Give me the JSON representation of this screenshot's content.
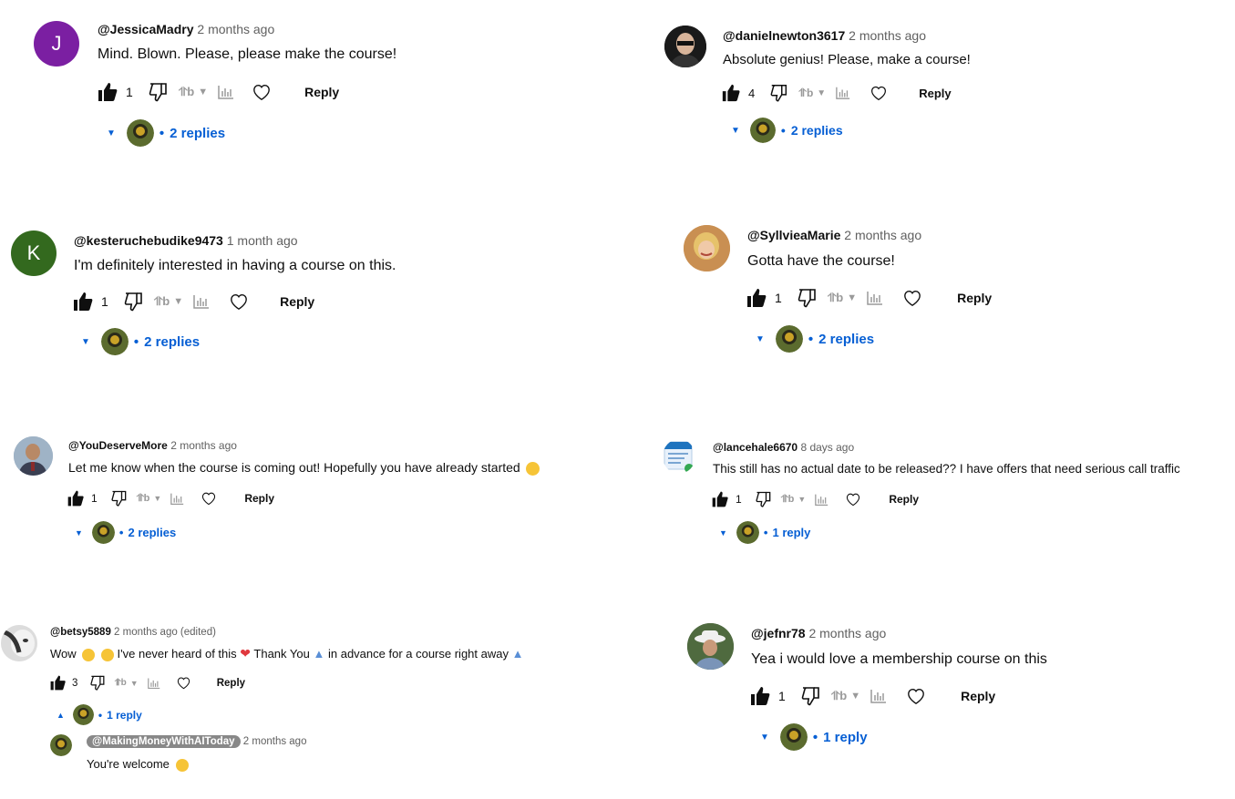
{
  "colors": {
    "link": "#065fd4",
    "muted": "#606060",
    "text": "#0f0f0f",
    "purple": "#7b1fa2",
    "green": "#33691e"
  },
  "comments": [
    {
      "author": "@JessicaMadry",
      "time": "2 months ago",
      "text": "Mind. Blown. Please, please make the course!",
      "likes": "1",
      "reply_label": "Reply",
      "replies": "2 replies",
      "avatar_letter": "J"
    },
    {
      "author": "@danielnewton3617",
      "time": "2 months ago",
      "text": "Absolute genius! Please, make a course!",
      "likes": "4",
      "reply_label": "Reply",
      "replies": "2 replies"
    },
    {
      "author": "@kesteruchebudike9473",
      "time": "1 month ago",
      "text": "I'm definitely interested in having a course on this.",
      "likes": "1",
      "reply_label": "Reply",
      "replies": "2 replies",
      "avatar_letter": "K"
    },
    {
      "author": "@SyllvieaMarie",
      "time": "2 months ago",
      "text": "Gotta have the course!",
      "likes": "1",
      "reply_label": "Reply",
      "replies": "2 replies"
    },
    {
      "author": "@YouDeserveMore",
      "time": "2 months ago",
      "text": "Let me know when the course is coming out! Hopefully you have already started",
      "likes": "1",
      "reply_label": "Reply",
      "replies": "2 replies"
    },
    {
      "author": "@lancehale6670",
      "time": "8 days ago",
      "text": "This still has no actual date to be released?? I have offers that need serious call traffic",
      "likes": "1",
      "reply_label": "Reply",
      "replies": "1 reply"
    },
    {
      "author": "@betsy5889",
      "time": "2 months ago (edited)",
      "text_a": "Wow",
      "text_b": "I've never heard of this",
      "text_c": "Thank You",
      "text_d": "in advance for a course right away",
      "likes": "3",
      "reply_label": "Reply",
      "replies": "1 reply"
    },
    {
      "author": "@jefnr78",
      "time": "2 months ago",
      "text": "Yea i would love a membership course on this",
      "likes": "1",
      "reply_label": "Reply",
      "replies": "1 reply"
    }
  ],
  "nested_reply": {
    "author": "@MakingMoneyWithAIToday",
    "time": "2 months ago",
    "text": "You're welcome"
  },
  "dot": "•"
}
